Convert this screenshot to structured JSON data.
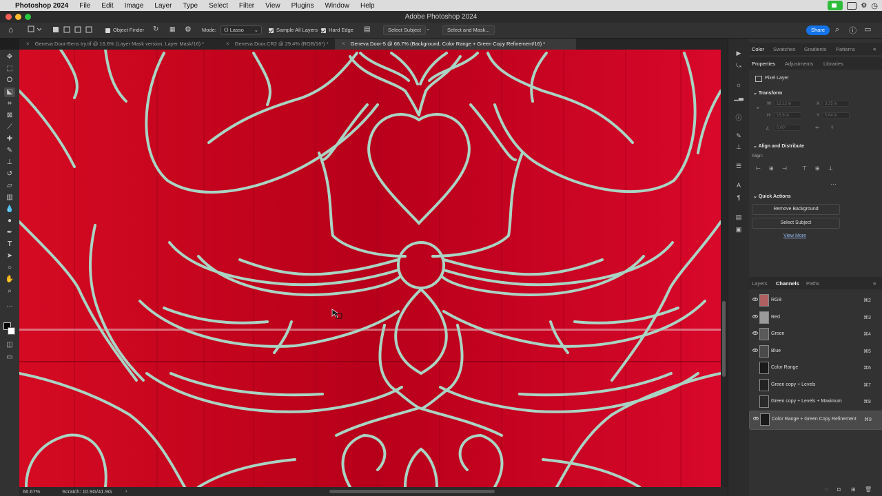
{
  "menubar": {
    "app_name": "Photoshop 2024",
    "items": [
      "File",
      "Edit",
      "Image",
      "Layer",
      "Type",
      "Select",
      "Filter",
      "View",
      "Plugins",
      "Window",
      "Help"
    ]
  },
  "window": {
    "title": "Adobe Photoshop 2024"
  },
  "options": {
    "object_finder": "Object Finder",
    "mode_label": "Mode:",
    "mode_value": "Lasso",
    "sample_all_layers": "Sample All Layers",
    "hard_edge": "Hard Edge",
    "select_subject": "Select Subject",
    "select_and_mask": "Select and Mask...",
    "share": "Share"
  },
  "tabs": [
    {
      "label": "Geneva Door-Bens try.tif @ 16.6% (Layer Mask version, Layer Mask/16) *"
    },
    {
      "label": "Geneva Door.CR2 @ 29.4% (RGB/16*) *"
    },
    {
      "label": "Geneva Door-5 @ 66.7% (Background, Color Range + Green Copy Refinement/16) *"
    }
  ],
  "status": {
    "zoom": "66.67%",
    "scratch": "Scratch: 10.9G/41.9G"
  },
  "panels": {
    "top_tabs": [
      "Color",
      "Swatches",
      "Gradients",
      "Patterns"
    ],
    "prop_tabs": [
      "Properties",
      "Adjustments",
      "Libraries"
    ],
    "pixel_layer": "Pixel Layer",
    "transform": "Transform",
    "transform_fields": {
      "w": "W",
      "w_val": "12.12 in",
      "x": "X",
      "x_val": "3.35 in",
      "h": "H",
      "h_val": "15.8 in",
      "y": "Y",
      "y_val": "5.64 in",
      "angle": "0.00°"
    },
    "align_distribute": "Align and Distribute",
    "align_label": "Align:",
    "quick_actions": "Quick Actions",
    "remove_background": "Remove Background",
    "select_subject": "Select Subject",
    "view_more": "View More",
    "layer_tabs": [
      "Layers",
      "Channels",
      "Paths"
    ]
  },
  "channels": [
    {
      "name": "RGB",
      "shortcut": "⌘2"
    },
    {
      "name": "Red",
      "shortcut": "⌘3"
    },
    {
      "name": "Green",
      "shortcut": "⌘4"
    },
    {
      "name": "Blue",
      "shortcut": "⌘5"
    },
    {
      "name": "Color Range",
      "shortcut": "⌘6"
    },
    {
      "name": "Green copy + Levels",
      "shortcut": "⌘7"
    },
    {
      "name": "Green copy + Levels + Maximum",
      "shortcut": "⌘8"
    },
    {
      "name": "Color Range + Green Copy Refinement",
      "shortcut": "⌘9"
    }
  ],
  "colors": {
    "accent": "#1473e6",
    "canvas_red": "#c5001a",
    "iron": "#a9d4c4"
  },
  "icons": [
    "home-icon",
    "move-icon",
    "marquee-icon",
    "lasso-icon",
    "object-select-icon",
    "crop-icon",
    "frame-icon",
    "eyedropper-icon",
    "healing-icon",
    "brush-icon",
    "stamp-icon",
    "history-brush-icon",
    "eraser-icon",
    "gradient-icon",
    "blur-icon",
    "dodge-icon",
    "pen-icon",
    "type-icon",
    "path-select-icon",
    "shape-icon",
    "hand-icon",
    "zoom-icon",
    "search-icon",
    "help-icon",
    "workspace-icon"
  ]
}
